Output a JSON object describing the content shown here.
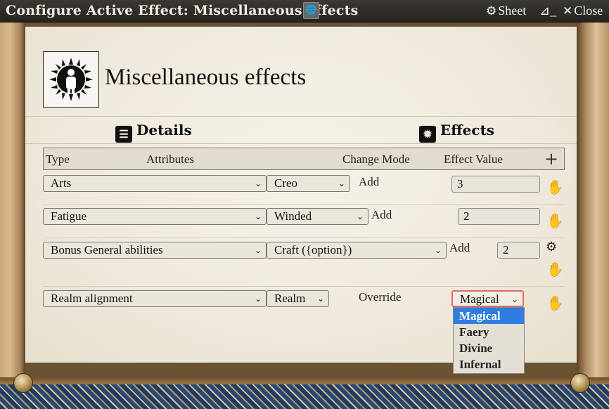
{
  "window": {
    "title": "Configure Active Effect: Miscellaneous effects",
    "sheet_label": "Sheet",
    "close_label": "Close"
  },
  "effect": {
    "name": "Miscellaneous effects"
  },
  "tabs": {
    "details": "Details",
    "effects": "Effects"
  },
  "table": {
    "headers": {
      "type": "Type",
      "attributes": "Attributes",
      "mode": "Change Mode",
      "value": "Effect Value"
    },
    "rows": [
      {
        "type": "Arts",
        "sub": "Creo",
        "mode": "Add",
        "value": "3"
      },
      {
        "type": "Fatigue",
        "sub": "Winded",
        "mode": "Add",
        "value": "2"
      },
      {
        "type": "Bonus General abilities",
        "sub": "Craft ({option})",
        "mode": "Add",
        "value": "2"
      },
      {
        "type": "Realm alignment",
        "sub": "Realm",
        "mode": "Override",
        "value": "Magical"
      }
    ]
  },
  "dropdown": {
    "options": [
      "Magical",
      "Faery",
      "Divine",
      "Infernal"
    ],
    "selected": "Magical"
  },
  "icons": {
    "sheet": "id-card-icon",
    "console": "terminal-icon",
    "close": "close-icon",
    "delete": "hand-icon",
    "config": "gears-icon",
    "add": "plus-icon"
  }
}
